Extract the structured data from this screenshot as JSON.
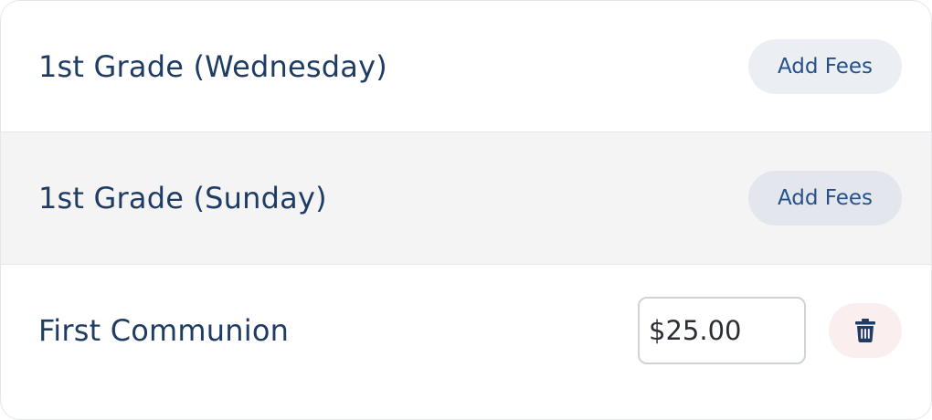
{
  "classes": [
    {
      "name": "1st Grade (Wednesday)",
      "action_label": "Add Fees"
    },
    {
      "name": "1st Grade (Sunday)",
      "action_label": "Add Fees"
    },
    {
      "name": "First Communion",
      "fee_value": "$25.00",
      "delete_icon": "trash-icon"
    }
  ],
  "colors": {
    "text": "#1f3c64",
    "button_text": "#25508a",
    "button_bg": "#ebeff4",
    "delete_bg": "#fbeeee",
    "alt_row_bg": "#f4f4f5"
  }
}
